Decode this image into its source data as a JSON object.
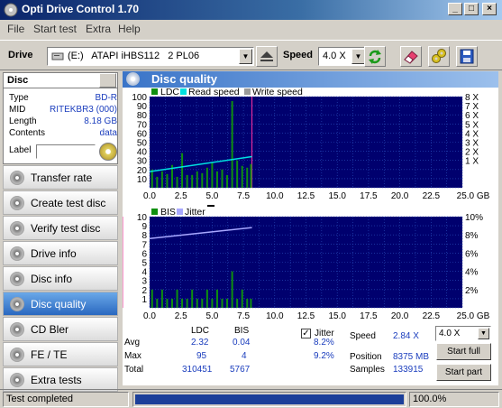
{
  "window": {
    "title": "Opti Drive Control 1.70"
  },
  "menu": [
    "File",
    "Start test",
    "Extra",
    "Help"
  ],
  "toolbar": {
    "drive_label": "Drive",
    "drive_value": "(E:)   ATAPI iHBS112   2 PL06",
    "speed_label": "Speed",
    "speed_value": "4.0 X"
  },
  "disc": {
    "header": "Disc",
    "rows": [
      {
        "key": "Type",
        "value": "BD-R"
      },
      {
        "key": "MID",
        "value": "RITEKBR3 (000)"
      },
      {
        "key": "Length",
        "value": "8.18 GB"
      },
      {
        "key": "Contents",
        "value": "data"
      }
    ],
    "label_key": "Label"
  },
  "nav": [
    {
      "label": "Transfer rate",
      "active": false
    },
    {
      "label": "Create test disc",
      "active": false
    },
    {
      "label": "Verify test disc",
      "active": false
    },
    {
      "label": "Drive info",
      "active": false
    },
    {
      "label": "Disc info",
      "active": false
    },
    {
      "label": "Disc quality",
      "active": true
    },
    {
      "label": "CD Bler",
      "active": false
    },
    {
      "label": "FE / TE",
      "active": false
    },
    {
      "label": "Extra tests",
      "active": false
    }
  ],
  "main": {
    "title": "Disc quality"
  },
  "colors": {
    "ldc": "#0f8f0f",
    "read": "#00e0e0",
    "write": "#9a9a9a",
    "bis": "#0f8f0f",
    "jitter": "#a8a8ff",
    "bg": "#00006e",
    "grid": "#2a4fbf",
    "marker": "#ff30a0"
  },
  "chart_data": [
    {
      "type": "bar",
      "legend": [
        "LDC",
        "Read speed",
        "Write speed"
      ],
      "x_ticks": [
        "0.0",
        "2.5",
        "5.0",
        "7.5",
        "10.0",
        "12.5",
        "15.0",
        "17.5",
        "20.0",
        "22.5",
        "25.0 GB"
      ],
      "y_ticks_left": [
        "100",
        "90",
        "80",
        "70",
        "60",
        "50",
        "40",
        "30",
        "20",
        "10"
      ],
      "y_ticks_right": [
        "8 X",
        "7 X",
        "6 X",
        "5 X",
        "4 X",
        "3 X",
        "2 X",
        "1 X"
      ],
      "xlim": [
        0,
        25
      ],
      "ylim": [
        0,
        100
      ],
      "disc_end_gb": 8.18,
      "ldc_series": {
        "x": [
          0.2,
          0.6,
          1.0,
          1.4,
          1.8,
          2.2,
          2.6,
          3.0,
          3.4,
          3.8,
          4.2,
          4.6,
          5.0,
          5.4,
          5.8,
          6.2,
          6.6,
          7.0,
          7.4,
          7.8,
          8.1
        ],
        "values": [
          20,
          12,
          18,
          15,
          25,
          12,
          38,
          14,
          14,
          18,
          16,
          22,
          28,
          18,
          20,
          14,
          95,
          30,
          24,
          22,
          26
        ]
      },
      "read_speed": {
        "x": [
          0,
          8.18
        ],
        "values": [
          1.5,
          2.9
        ]
      }
    },
    {
      "type": "bar",
      "legend": [
        "BIS",
        "Jitter"
      ],
      "x_ticks": [
        "0.0",
        "2.5",
        "5.0",
        "7.5",
        "10.0",
        "12.5",
        "15.0",
        "17.5",
        "20.0",
        "22.5",
        "25.0 GB"
      ],
      "y_ticks_left": [
        "10",
        "9",
        "8",
        "7",
        "6",
        "5",
        "4",
        "3",
        "2",
        "1"
      ],
      "y_ticks_right": [
        "10%",
        "8%",
        "6%",
        "4%",
        "2%"
      ],
      "xlim": [
        0,
        25
      ],
      "ylim": [
        0,
        10
      ],
      "bis_series": {
        "x": [
          0.2,
          0.6,
          1.0,
          1.4,
          1.8,
          2.2,
          2.6,
          3.0,
          3.4,
          3.8,
          4.2,
          4.6,
          5.0,
          5.4,
          5.8,
          6.2,
          6.6,
          7.0,
          7.4,
          7.8,
          8.1
        ],
        "values": [
          2,
          1,
          2,
          1,
          1,
          2,
          1,
          1,
          2,
          1,
          1,
          2,
          1,
          2,
          1,
          1,
          4,
          1,
          2,
          1,
          1
        ]
      },
      "jitter": {
        "x": [
          0,
          8.18
        ],
        "values": [
          7.6,
          8.8
        ]
      }
    }
  ],
  "stats": {
    "headers": [
      "LDC",
      "BIS"
    ],
    "avg_label": "Avg",
    "avg": [
      "2.32",
      "0.04"
    ],
    "max_label": "Max",
    "max": [
      "95",
      "4"
    ],
    "total_label": "Total",
    "total": [
      "310451",
      "5767"
    ],
    "jitter_label": "Jitter",
    "jitter_checked": true,
    "jitter_avg": "8.2%",
    "jitter_max": "9.2%"
  },
  "right_stats": {
    "speed_label": "Speed",
    "speed_value": "2.84 X",
    "position_label": "Position",
    "position_value": "8375 MB",
    "samples_label": "Samples",
    "samples_value": "133915",
    "speed_combo": "4.0 X",
    "start_full": "Start full",
    "start_part": "Start part"
  },
  "status": {
    "text": "Test completed",
    "progress_pct": 100,
    "progress_text": "100.0%"
  }
}
